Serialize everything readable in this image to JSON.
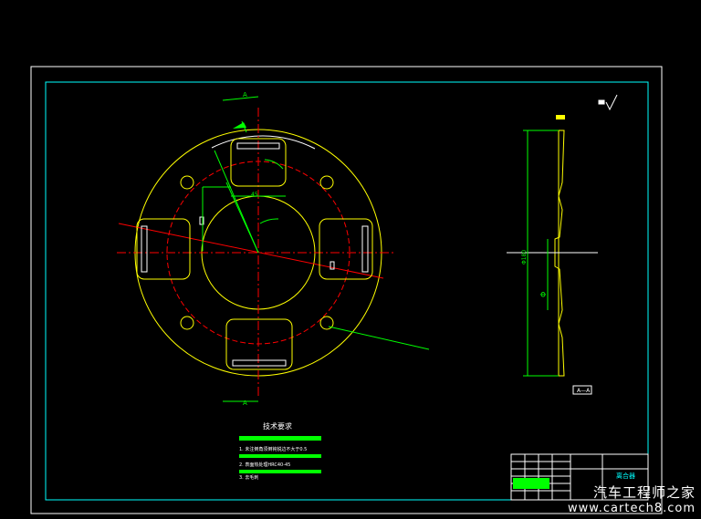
{
  "drawing": {
    "section_marker_top": "A",
    "section_marker_bottom": "A",
    "dimension_slot_width": "45",
    "dimension_right_diameter": "Φ180",
    "dimension_right_mid": "Φ",
    "right_view_label": "A—A"
  },
  "notes": {
    "title": "技术要求",
    "items": [
      "1. 未注倒角须倒钝锐边不大于0.5",
      "2. 表面热处理HRC40-45",
      "3. 去毛刺"
    ]
  },
  "title_block": {
    "part_name": "离合器"
  },
  "watermark": {
    "line1": "汽车工程师之家",
    "line2": "www.cartech8.com"
  },
  "colors": {
    "border": "#ffffff",
    "frame": "#00ffff",
    "outline": "#ffff00",
    "centerline": "#ff0000",
    "dimension": "#00ff00"
  }
}
